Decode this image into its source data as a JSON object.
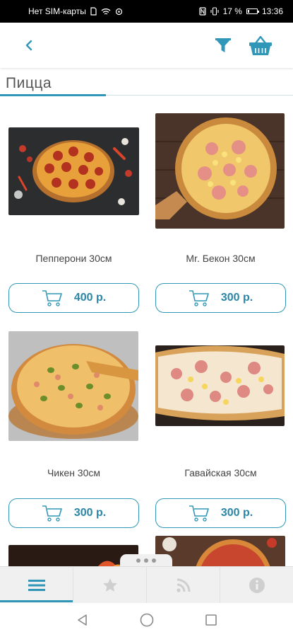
{
  "status_bar": {
    "carrier": "Нет SIM-карты",
    "battery_percent": "17 %",
    "time": "13:36",
    "battery_level": 0.17
  },
  "app_bar": {
    "back_icon": "chevron-left-icon",
    "filter_icon": "filter-icon",
    "basket_icon": "basket-icon"
  },
  "section": {
    "title": "Пицца"
  },
  "products": [
    {
      "name": "Пепперони 30см",
      "price": "400 р."
    },
    {
      "name": "Mr. Бекон 30см",
      "price": "300 р."
    },
    {
      "name": "Чикен 30см",
      "price": "300 р."
    },
    {
      "name": "Гавайская 30см",
      "price": "300 р."
    }
  ],
  "tabs": [
    {
      "icon": "menu-icon",
      "active": true
    },
    {
      "icon": "star-icon",
      "active": false
    },
    {
      "icon": "rss-icon",
      "active": false
    },
    {
      "icon": "info-icon",
      "active": false
    }
  ],
  "colors": {
    "accent": "#3197b8",
    "price_text": "#2b86a8",
    "tab_bar_bg": "#f0f0f0",
    "inactive_icon": "#cfcfcf"
  }
}
